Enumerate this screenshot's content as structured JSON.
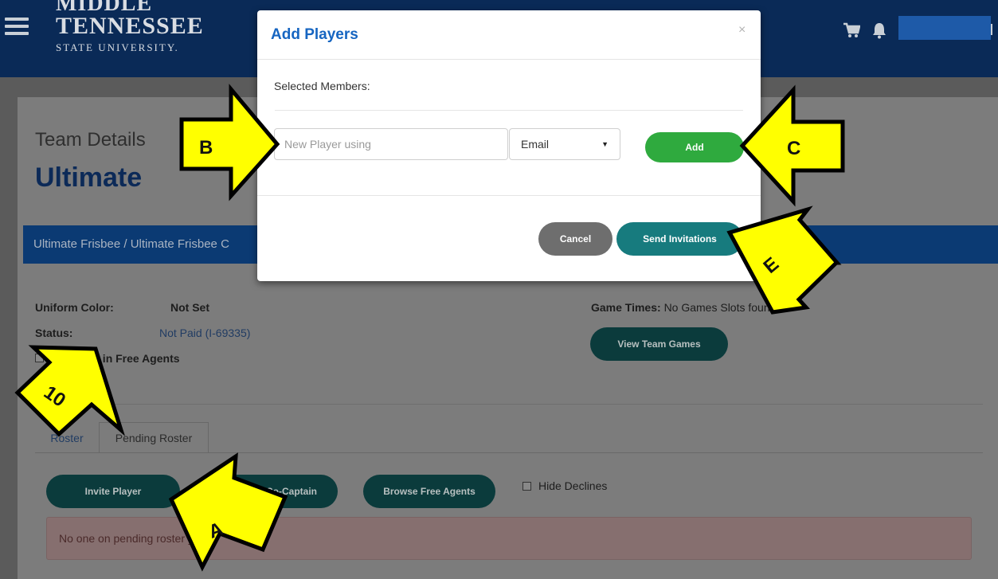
{
  "header": {
    "logo_line1": "MIDDLE",
    "logo_line2": "TENNESSEE",
    "logo_line3": "STATE UNIVERSITY.",
    "icons": [
      "menu-icon",
      "cart-icon",
      "bell-icon"
    ]
  },
  "team": {
    "details_label": "Team Details",
    "name": "Ultimate",
    "breadcrumb": "Ultimate Frisbee / Ultimate Frisbee C"
  },
  "info": {
    "uniform_label": "Uniform Color:",
    "uniform_value": "Not Set",
    "status_label": "Status:",
    "status_value": "Not Paid (I-69335)",
    "free_agents_label": "Interested in Free Agents",
    "game_times_label": "Game Times:",
    "game_times_value": "No Games Slots found",
    "view_games_button": "View Team Games"
  },
  "tabs": [
    {
      "label": "Roster"
    },
    {
      "label": "Pending Roster"
    }
  ],
  "actions": {
    "invite_player": "Invite Player",
    "co_captain": "Co-Captain",
    "browse_free_agents": "Browse Free Agents",
    "hide_declines": "Hide Declines"
  },
  "pending": {
    "empty_text": "No one on pending roster yet"
  },
  "modal": {
    "title": "Add Players",
    "close": "×",
    "selected_members_label": "Selected Members:",
    "new_player_placeholder": "New Player using",
    "method_selected": "Email",
    "add_button": "Add",
    "cancel_button": "Cancel",
    "send_button": "Send Invitations"
  },
  "annotations": {
    "arrow_b": "B",
    "arrow_c": "C",
    "arrow_e": "E",
    "arrow_a": "A",
    "arrow_step": "10"
  },
  "colors": {
    "header_bg": "#0a2a57",
    "modal_title": "#1665c1",
    "add_green": "#2faa3e",
    "send_teal": "#177b7e",
    "arrow_yellow": "#ffff00"
  }
}
